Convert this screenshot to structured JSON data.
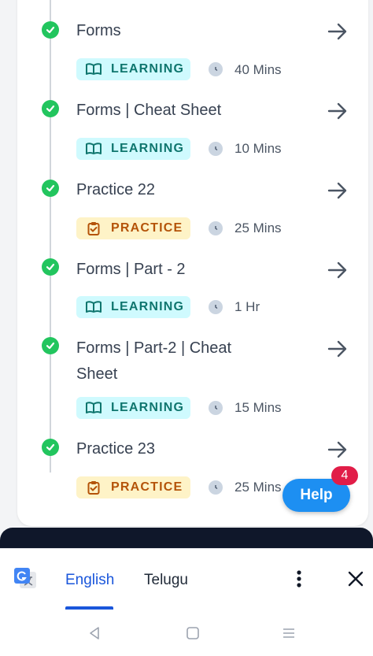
{
  "course_items": [
    {
      "title": "Forms",
      "type_label": "LEARNING",
      "type": "learning",
      "duration": "40 Mins"
    },
    {
      "title": "Forms | Cheat Sheet",
      "type_label": "LEARNING",
      "type": "learning",
      "duration": "10 Mins"
    },
    {
      "title": "Practice 22",
      "type_label": "PRACTICE",
      "type": "practice",
      "duration": "25 Mins"
    },
    {
      "title": "Forms | Part - 2",
      "type_label": "LEARNING",
      "type": "learning",
      "duration": "1 Hr"
    },
    {
      "title": "Forms | Part-2 | Cheat Sheet",
      "type_label": "LEARNING",
      "type": "learning",
      "duration": "15 Mins"
    },
    {
      "title": "Practice 23",
      "type_label": "PRACTICE",
      "type": "practice",
      "duration": "25 Mins"
    }
  ],
  "help": {
    "label": "Help",
    "count": "4"
  },
  "translate_bar": {
    "languages": [
      "English",
      "Telugu"
    ],
    "selected": "English"
  },
  "colors": {
    "complete_check": "#22c55e",
    "learning_badge_bg": "#cffafe",
    "learning_badge_text": "#0f766e",
    "practice_badge_bg": "#fef3c7",
    "practice_badge_text": "#b45309",
    "help_button": "#1d8ff2",
    "help_count": "#e11d48",
    "active_language": "#1a56db"
  },
  "icons": {
    "status": "check-circle-icon",
    "open": "arrow-right-icon",
    "learning": "book-open-icon",
    "practice": "clipboard-check-icon",
    "duration": "clock-icon",
    "translate": "google-translate-icon",
    "more": "more-vertical-icon",
    "close": "close-icon"
  }
}
